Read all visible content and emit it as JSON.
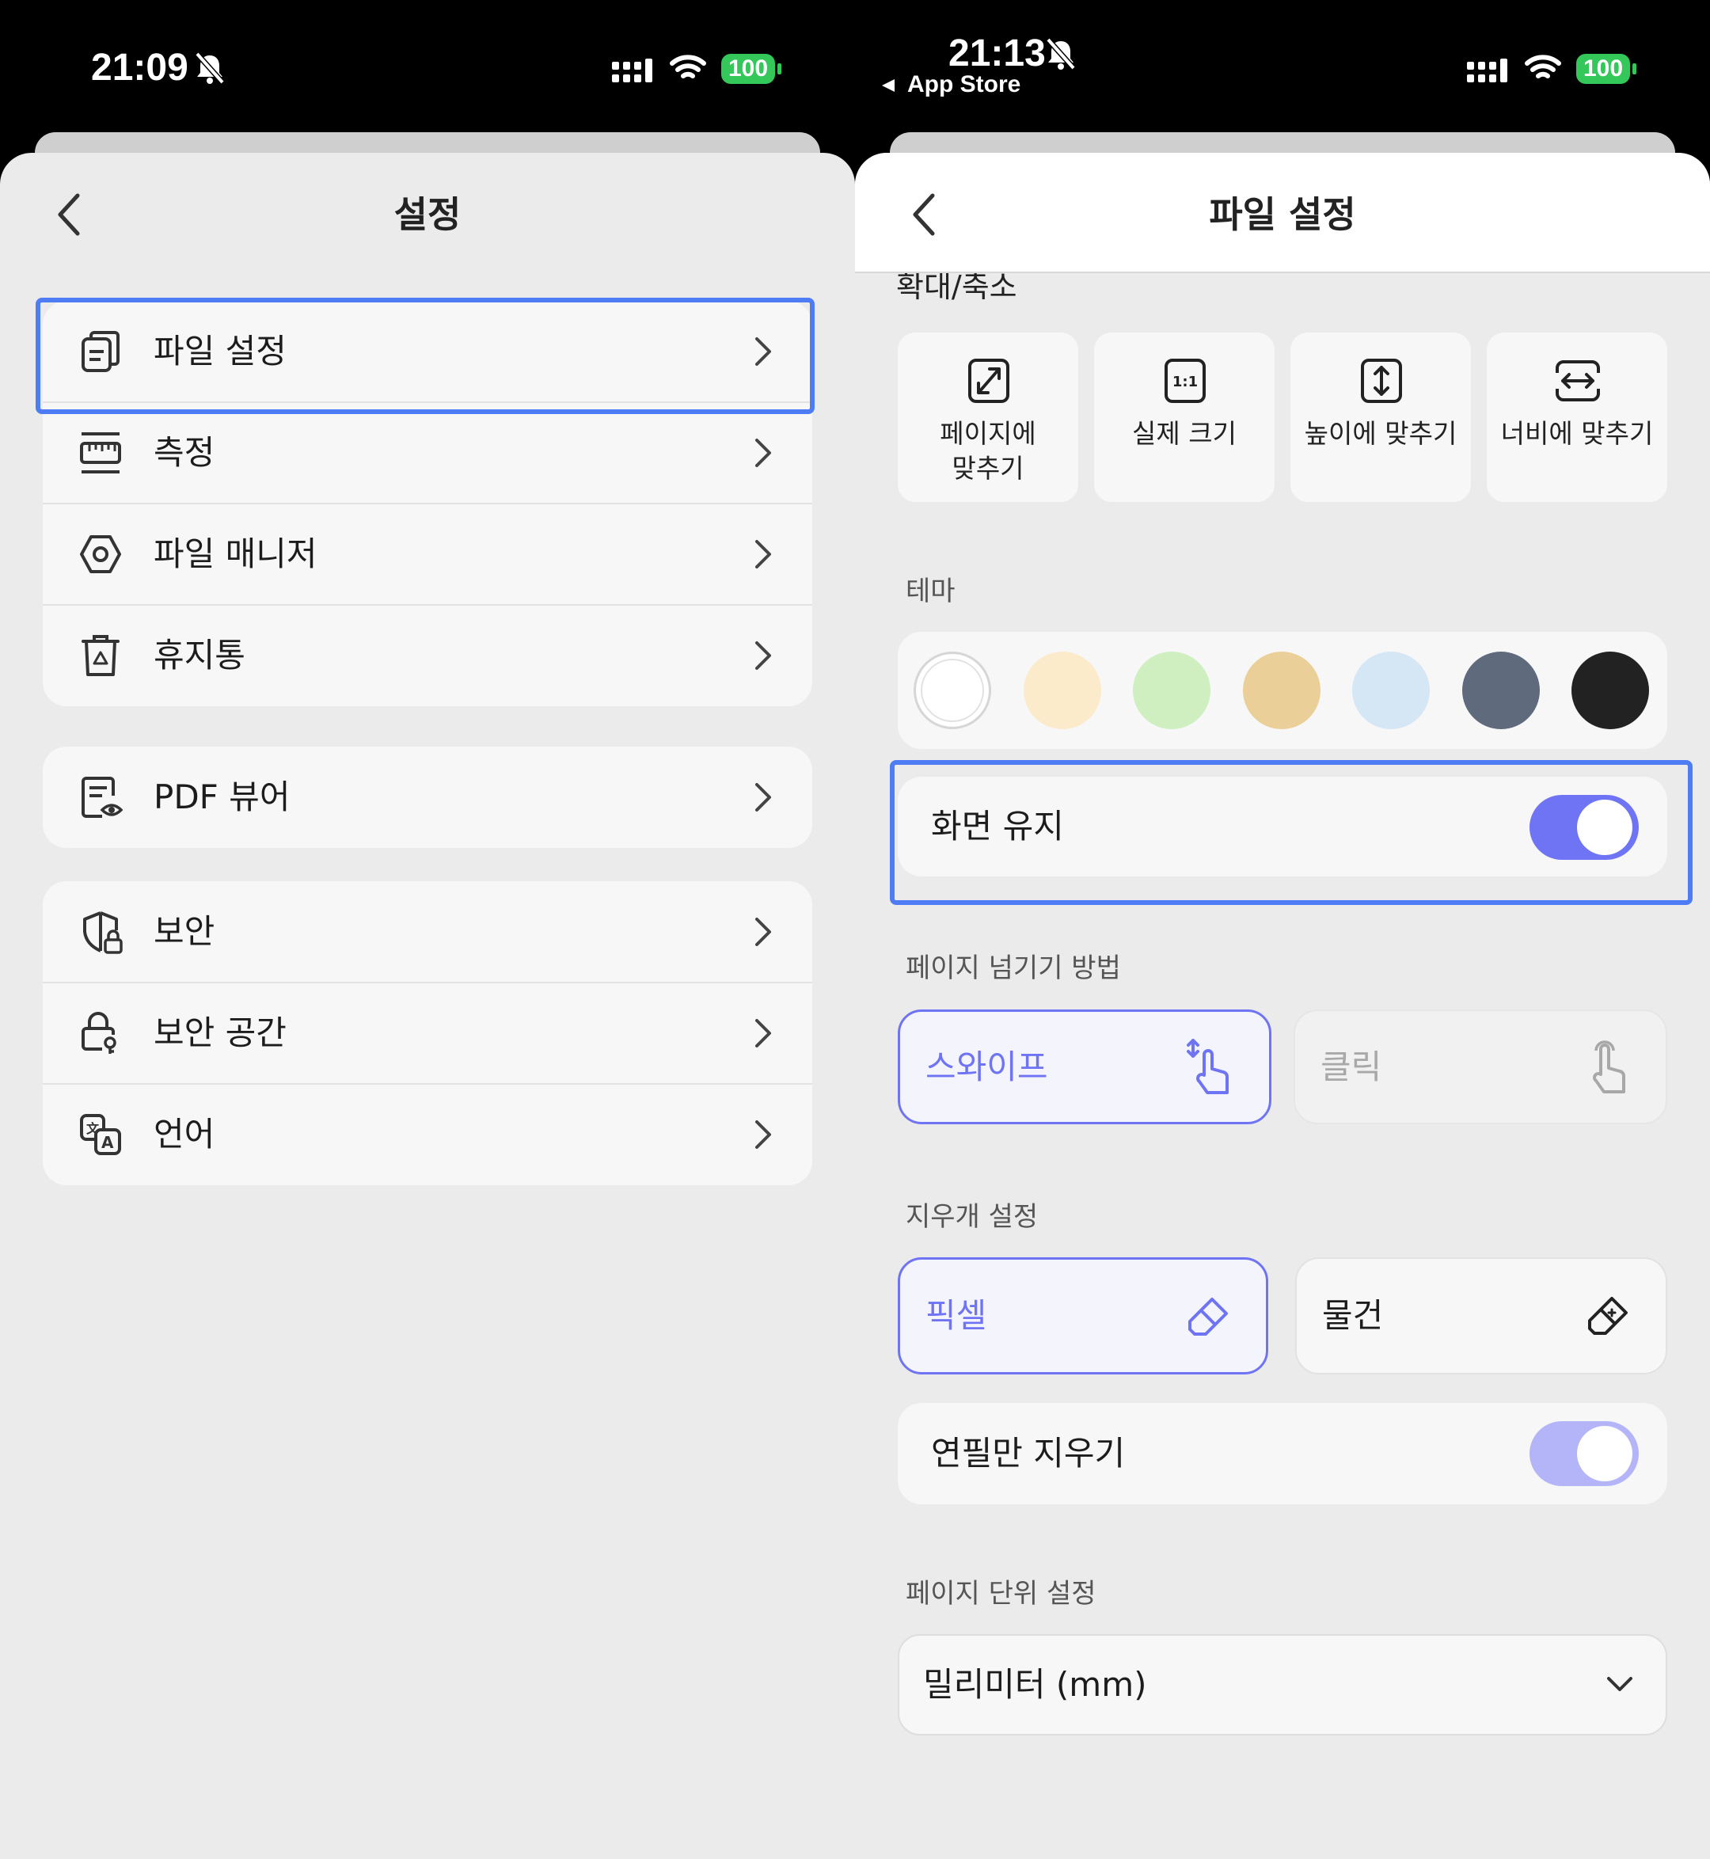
{
  "left": {
    "status": {
      "time": "21:09",
      "battery": "100"
    },
    "title": "설정",
    "groups": [
      [
        {
          "label": "파일 설정",
          "icon": "file-settings-icon"
        },
        {
          "label": "측정",
          "icon": "ruler-icon"
        },
        {
          "label": "파일 매니저",
          "icon": "hexagon-nut-icon"
        },
        {
          "label": "휴지통",
          "icon": "trash-icon"
        }
      ],
      [
        {
          "label": "PDF 뷰어",
          "icon": "pdf-viewer-icon"
        }
      ],
      [
        {
          "label": "보안",
          "icon": "shield-icon"
        },
        {
          "label": "보안 공간",
          "icon": "lock-key-icon"
        },
        {
          "label": "언어",
          "icon": "language-icon"
        }
      ]
    ]
  },
  "right": {
    "status": {
      "time": "21:13",
      "back_app": "App Store",
      "battery": "100"
    },
    "title": "파일 설정",
    "zoom": {
      "label": "확대/축소",
      "options": [
        "페이지에\n맞추기",
        "실제 크기",
        "높이에 맞추기",
        "너비에 맞추기"
      ],
      "icon_text_actual": "1:1"
    },
    "theme": {
      "label": "테마",
      "colors": [
        "#ffffff",
        "#fbebcb",
        "#cfefc1",
        "#ebcf98",
        "#d5e6f5",
        "#5f6a7c",
        "#222222"
      ],
      "selected_index": 0
    },
    "keep_screen": {
      "label": "화면 유지",
      "on": true
    },
    "page_turn": {
      "label": "페이지 넘기기 방법",
      "options": [
        "스와이프",
        "클릭"
      ],
      "selected_index": 0
    },
    "eraser": {
      "label": "지우개 설정",
      "options": [
        "픽셀",
        "물건"
      ],
      "selected_index": 0
    },
    "pencil_only": {
      "label": "연필만 지우기",
      "on": true
    },
    "page_unit": {
      "label": "페이지 단위 설정",
      "value": "밀리미터 (mm)"
    },
    "accent": "#6f74f5"
  }
}
